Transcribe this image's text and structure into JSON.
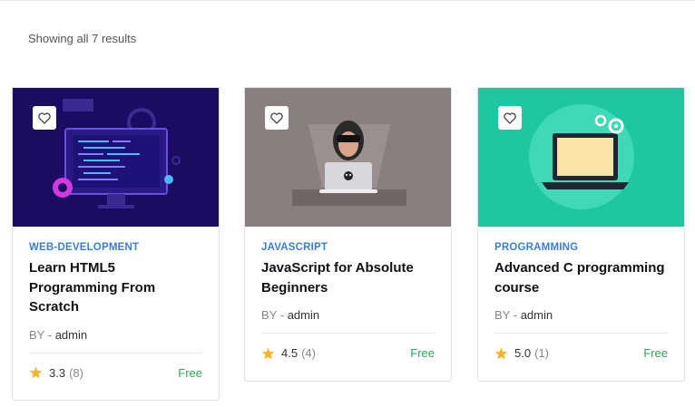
{
  "results_text": "Showing all 7 results",
  "courses": [
    {
      "category": "WEB-DEVELOPMENT",
      "title": "Learn HTML5 Programming From Scratch",
      "by_label": "BY -",
      "author": "admin",
      "rating": "3.3",
      "reviews": "(8)",
      "price": "Free",
      "thumb_bg": "#1c0b63"
    },
    {
      "category": "JAVASCRIPT",
      "title": "JavaScript for Absolute Beginners",
      "by_label": "BY -",
      "author": "admin",
      "rating": "4.5",
      "reviews": "(4)",
      "price": "Free",
      "thumb_bg": "#8a7f7f"
    },
    {
      "category": "PROGRAMMING",
      "title": "Advanced C programming course",
      "by_label": "BY -",
      "author": "admin",
      "rating": "5.0",
      "reviews": "(1)",
      "price": "Free",
      "thumb_bg": "#1ec7a0"
    }
  ],
  "colors": {
    "category": "#3b7fd0",
    "price": "#31a55a",
    "star": "#f5b52e"
  },
  "icons": {
    "wishlist": "heart-icon",
    "rating": "star-icon"
  }
}
